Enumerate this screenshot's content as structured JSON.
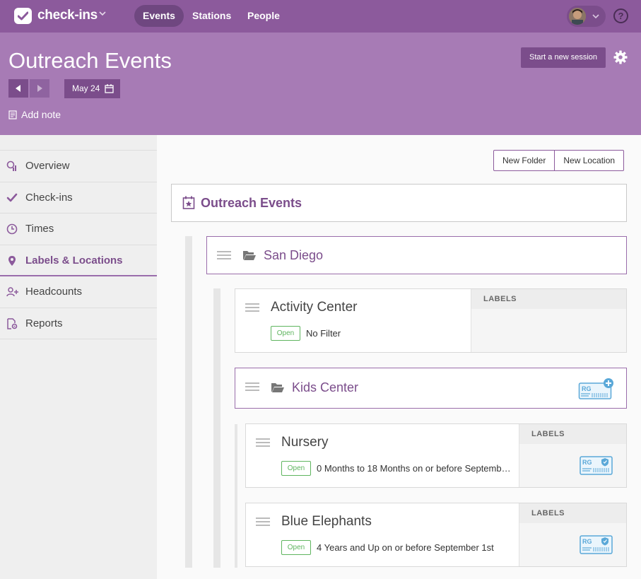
{
  "app": {
    "name": "check-ins"
  },
  "nav": {
    "items": [
      "Events",
      "Stations",
      "People"
    ]
  },
  "header": {
    "title": "Outreach Events",
    "date": "May 24",
    "add_note": "Add note",
    "session_button": "Start a new session"
  },
  "sidebar": {
    "items": [
      {
        "label": "Overview",
        "icon": "chart-icon"
      },
      {
        "label": "Check-ins",
        "icon": "check-icon"
      },
      {
        "label": "Times",
        "icon": "clock-icon"
      },
      {
        "label": "Labels & Locations",
        "icon": "map-pin-icon",
        "active": true
      },
      {
        "label": "Headcounts",
        "icon": "people-add-icon"
      },
      {
        "label": "Reports",
        "icon": "report-gear-icon"
      }
    ]
  },
  "toolbar": {
    "new_folder": "New Folder",
    "new_location": "New Location"
  },
  "event": {
    "title": "Outreach Events"
  },
  "folders": {
    "san_diego": "San Diego",
    "kids_center": "Kids Center"
  },
  "labels_header": "LABELS",
  "label_icon_text": "RG",
  "locations": [
    {
      "name": "Activity Center",
      "status": "Open",
      "filter": "No Filter"
    },
    {
      "name": "Nursery",
      "status": "Open",
      "filter": "0 Months to 18 Months on or before Septemb…"
    },
    {
      "name": "Blue Elephants",
      "status": "Open",
      "filter": "4 Years and Up on or before September 1st"
    }
  ],
  "colors": {
    "brand": "#8c5a9c",
    "header": "#a77bb5",
    "open": "#5fb55f",
    "label_icon": "#5aa8d8"
  }
}
